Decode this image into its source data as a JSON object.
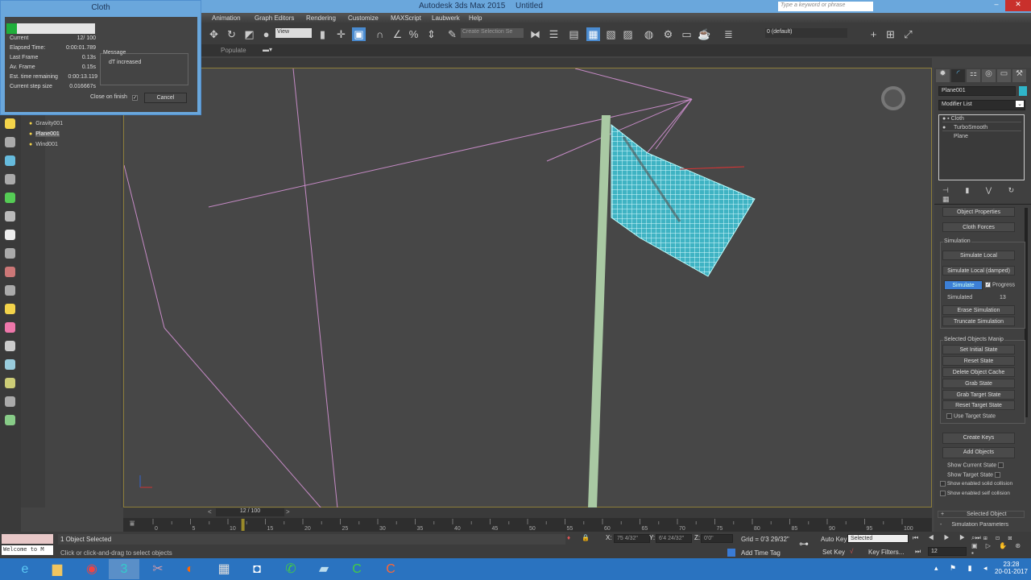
{
  "window": {
    "app_title": "Autodesk 3ds Max  2015",
    "doc_title": "Untitled",
    "search_placeholder": "Type a keyword or phrase"
  },
  "menu": [
    "Animation",
    "Graph Editors",
    "Rendering",
    "Customize",
    "MAXScript",
    "Laubwerk",
    "Help"
  ],
  "toolbar": {
    "view_select": "View",
    "selection_set": "Create Selection Se",
    "layer": "0 (default)"
  },
  "ribbon": {
    "populate": "Populate"
  },
  "explorer": {
    "items": [
      {
        "name": "Gravity001",
        "selected": false
      },
      {
        "name": "Plane001",
        "selected": true
      },
      {
        "name": "Wind001",
        "selected": false
      }
    ]
  },
  "dialog": {
    "title": "Cloth",
    "progress": 0.12,
    "rows": [
      {
        "label": "Current",
        "value": "12/  100"
      },
      {
        "label": "Elapsed Time:",
        "value": "0:00:01.789"
      },
      {
        "label": "Last Frame",
        "value": "0.13s"
      },
      {
        "label": "Av. Frame",
        "value": "0.15s"
      },
      {
        "label": "Est. time remaining",
        "value": "0:00:13.119"
      },
      {
        "label": "Current step size",
        "value": "0.016667s"
      }
    ],
    "message_label": "Message",
    "message": "dT increased",
    "close_on_finish": "Close on finish",
    "close_on_finish_checked": true,
    "cancel": "Cancel"
  },
  "command_panel": {
    "object_name": "Plane001",
    "object_color": "#2fb5c9",
    "modifier_list": "Modifier List",
    "stack": [
      "Cloth",
      "TurboSmooth",
      "Plane"
    ],
    "object_properties": "Object Properties",
    "cloth_forces": "Cloth Forces",
    "simulation": {
      "label": "Simulation",
      "simulate_local": "Simulate Local",
      "simulate_local_damped": "Simulate Local (damped)",
      "simulate": "Simulate",
      "progress": "Progress",
      "progress_checked": true,
      "simulated_label": "Simulated",
      "simulated_value": "13",
      "erase": "Erase Simulation",
      "truncate": "Truncate Simulation"
    },
    "manip": {
      "label": "Selected Objects Manip",
      "buttons": [
        "Set Initial State",
        "Reset State",
        "Delete Object Cache",
        "Grab State",
        "Grab Target State",
        "Reset Target State"
      ],
      "use_target_state": "Use Target State"
    },
    "create_keys": "Create Keys",
    "add_objects": "Add Objects",
    "checks": [
      "Show Current State",
      "Show Target State",
      "Show enabled solid collision",
      "Show enabled self collision"
    ],
    "rollouts": [
      {
        "sign": "+",
        "label": "Selected Object"
      },
      {
        "sign": "-",
        "label": "Simulation Parameters"
      }
    ]
  },
  "timeline": {
    "slider": "12 / 100",
    "current": 12,
    "max": 100,
    "ticks": [
      "0",
      "5",
      "10",
      "15",
      "20",
      "25",
      "30",
      "35",
      "40",
      "45",
      "50",
      "55",
      "60",
      "65",
      "70",
      "75",
      "80",
      "85",
      "90",
      "95",
      "100"
    ]
  },
  "status": {
    "selected": "1 Object Selected",
    "prompt": "Click or click-and-drag to select objects",
    "maxscript": "Welcome to M",
    "x": "75 4/32\"",
    "y": "6'4 24/32\"",
    "z": "0'0\"",
    "grid": "Grid = 0'3 29/32\"",
    "add_time_tag": "Add Time Tag",
    "auto_key": "Auto Key",
    "set_key": "Set Key",
    "key_mode": "Selected",
    "key_filters": "Key Filters...",
    "frame": "12"
  },
  "taskbar": {
    "time": "23:28",
    "date": "20-01-2017"
  }
}
